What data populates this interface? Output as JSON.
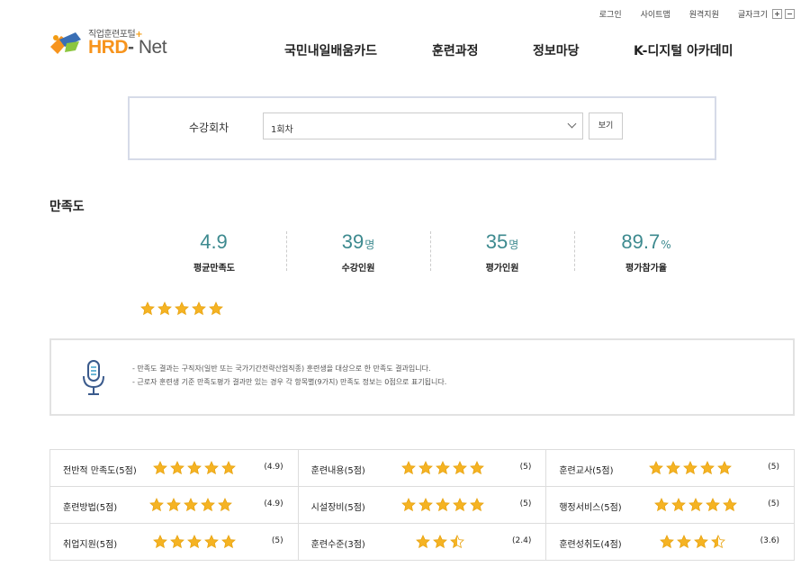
{
  "utility": {
    "login": "로그인",
    "sitemap": "사이트맵",
    "remote": "원격지원",
    "font_size": "글자크기"
  },
  "logo": {
    "subtitle": "직업훈련포털",
    "name": "HRD",
    "dash": "-",
    "name2": "Net"
  },
  "nav": [
    "국민내일배움카드",
    "훈련과정",
    "정보마당",
    "K-디지털 아카데미"
  ],
  "session": {
    "label": "수강회차",
    "selected": "1회차",
    "view_label": "보기"
  },
  "satisfaction": {
    "title": "만족도",
    "stats": [
      {
        "value": "4.9",
        "unit": "",
        "caption": "평균만족도"
      },
      {
        "value": "39",
        "unit": "명",
        "caption": "수강인원"
      },
      {
        "value": "35",
        "unit": "명",
        "caption": "평가인원"
      },
      {
        "value": "89.7",
        "unit": "%",
        "caption": "평가참가율"
      }
    ],
    "average_rating": 4.9,
    "max_rating": 5
  },
  "notice": {
    "lines": [
      "- 만족도 결과는 구직자(일반 또는 국가기간전략산업직종) 훈련생을 대상으로 한 만족도 결과입니다.",
      "- 근로자 훈련생 기준 만족도평가 결과만 있는 경우 각 항목별(9가지) 만족도 정보는 0점으로 표기됩니다."
    ]
  },
  "ratings": [
    [
      {
        "name": "전반적 만족도(5점)",
        "score": "(4.9)",
        "rating": 4.9,
        "max": 5
      },
      {
        "name": "훈련내용(5점)",
        "score": "(5)",
        "rating": 5,
        "max": 5
      },
      {
        "name": "훈련교사(5점)",
        "score": "(5)",
        "rating": 5,
        "max": 5
      }
    ],
    [
      {
        "name": "훈련방법(5점)",
        "score": "(4.9)",
        "rating": 4.9,
        "max": 5
      },
      {
        "name": "시설장비(5점)",
        "score": "(5)",
        "rating": 5,
        "max": 5
      },
      {
        "name": "행정서비스(5점)",
        "score": "(5)",
        "rating": 5,
        "max": 5
      }
    ],
    [
      {
        "name": "취업지원(5점)",
        "score": "(5)",
        "rating": 5,
        "max": 5
      },
      {
        "name": "훈련수준(3점)",
        "score": "(2.4)",
        "rating": 2.4,
        "max": 3
      },
      {
        "name": "훈련성취도(4점)",
        "score": "(3.6)",
        "rating": 3.6,
        "max": 4
      }
    ]
  ],
  "colors": {
    "accent": "#3d8a8f",
    "star": "#f5b323",
    "star_empty": "#cccccc",
    "logo_orange": "#f7941d"
  }
}
